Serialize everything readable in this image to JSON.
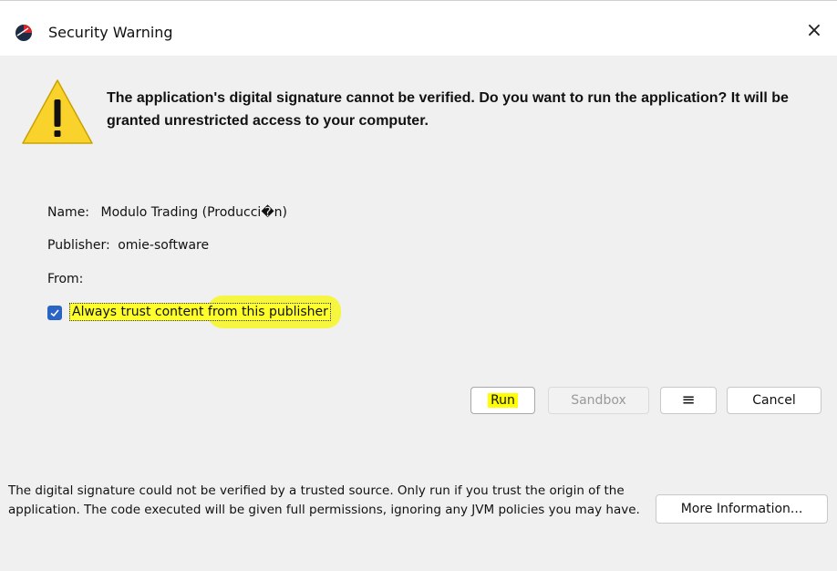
{
  "window": {
    "title": "Security Warning",
    "close_glyph": "×",
    "app_icon": "java-app-icon"
  },
  "warning": {
    "icon": "warning-triangle-icon",
    "headline": "The application's digital signature cannot be verified. Do you want to run the application? It will be granted unrestricted access to your computer."
  },
  "details": {
    "name_label": "Name:",
    "name_value": "Modulo Trading (Producci�n)",
    "publisher_label": "Publisher:",
    "publisher_value": "omie-software",
    "from_label": "From:",
    "from_value": ""
  },
  "trust": {
    "checked": true,
    "label": "Always trust content from this publisher"
  },
  "buttons": {
    "run": "Run",
    "sandbox": "Sandbox",
    "menu": "≡",
    "cancel": "Cancel",
    "more_info": "More Information..."
  },
  "footer": {
    "text": "The digital signature could not be verified by a trusted source. Only run if you trust the origin of the application. The code executed will be given full permissions, ignoring any JVM policies you may have."
  },
  "colors": {
    "highlight": "#ffff2a",
    "checkbox": "#2a64c5",
    "warning": "#f9d32c"
  }
}
